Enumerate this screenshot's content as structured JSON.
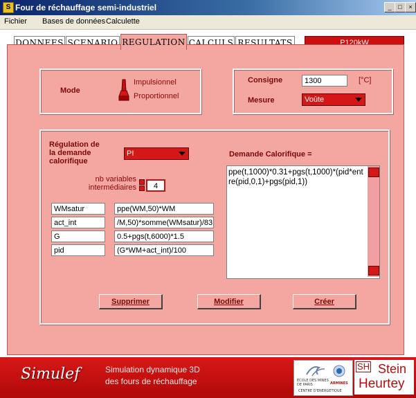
{
  "window": {
    "title": "Four de réchauffage semi-industriel",
    "icon_letter": "S",
    "controls": [
      "_",
      "□",
      "×"
    ]
  },
  "menu": [
    "Fichier",
    "Bases de données",
    "Calculette"
  ],
  "tabs": [
    "DONNEES",
    "SCENARIO",
    "REGULATION",
    "CALCULS",
    "RESULTATS"
  ],
  "active_tab": "REGULATION",
  "model_tag": "P120kW",
  "mode": {
    "label": "Mode",
    "option1": "Impulsionnel",
    "option2": "Proportionnel"
  },
  "consigne": {
    "label": "Consigne",
    "value": "1300",
    "unit": "[°C]"
  },
  "mesure": {
    "label": "Mesure",
    "value": "Voûte"
  },
  "regulation": {
    "label_line1": "Régulation de",
    "label_line2": "la demande",
    "label_line3": "calorifique",
    "value": "PI"
  },
  "nb_vars": {
    "label_line1": "nb variables",
    "label_line2": "intermédiaires",
    "value": "4"
  },
  "variables": [
    {
      "name": "WMsatur",
      "expr": "ppe(WM,50)*WM"
    },
    {
      "name": "act_int",
      "expr": "/M,50)*somme(WMsatur)/83"
    },
    {
      "name": "G",
      "expr": "0.5+pgs(t,6000)*1.5"
    },
    {
      "name": "pid",
      "expr": "(G*WM+act_int)/100"
    }
  ],
  "demande": {
    "label": "Demande Calorifique =",
    "formula": "ppe(t,1000)*0.31+pgs(t,1000)*(pid*entre(pid,0,1)+pgs(pid,1))"
  },
  "buttons": {
    "supprimer": "Supprimer",
    "modifier": "Modifier",
    "creer": "Créer"
  },
  "footer": {
    "brand": "Simulef",
    "line1": "Simulation dynamique 3D",
    "line2": "des fours de réchauffage",
    "school_line1": "ECOLE DES MINES",
    "school_line2": "DE PARIS",
    "armines": "ARMINES",
    "centre": "CENTRE D'ENERGETIQUE",
    "stein_sh": "SH",
    "stein_line1": "Stein",
    "stein_line2": "Heurtey"
  },
  "colors": {
    "panel": "#f4a6a0",
    "accent_red": "#d41818",
    "dark_red_text": "#7a0a0a"
  }
}
